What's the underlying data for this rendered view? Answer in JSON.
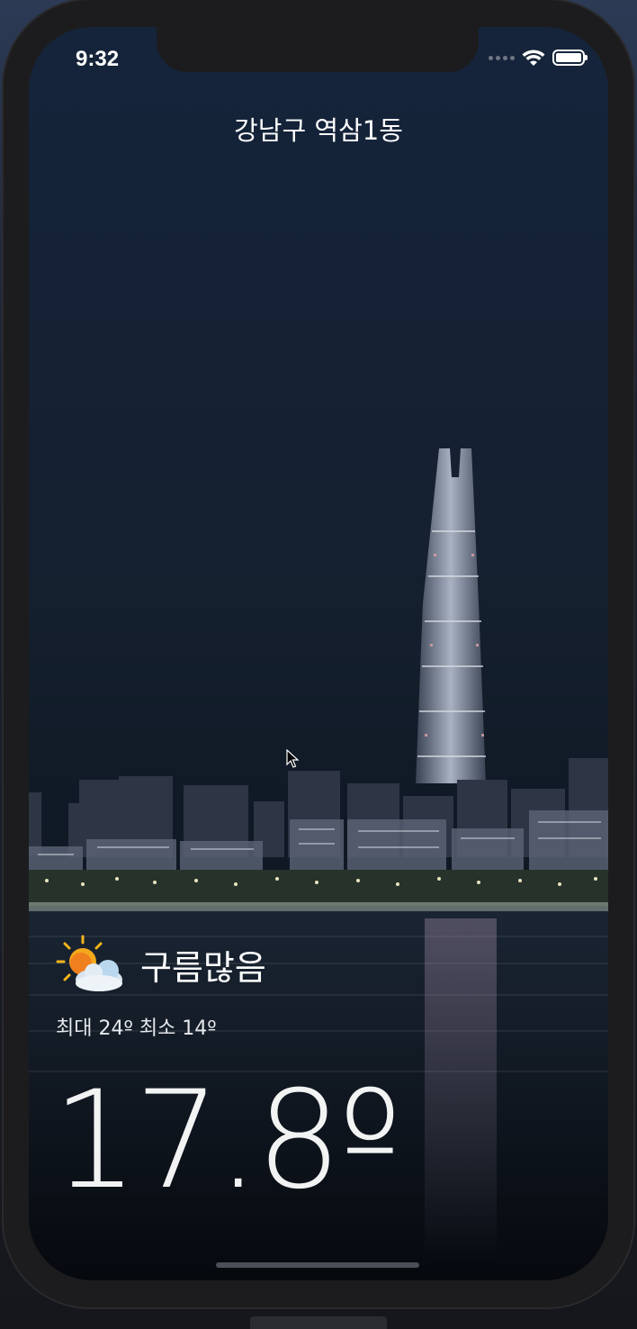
{
  "status_bar": {
    "time": "9:32",
    "icons": [
      "signal-dots-icon",
      "wifi-icon",
      "battery-icon"
    ]
  },
  "location": "강남구 역삼1동",
  "weather": {
    "condition": "구름많음",
    "condition_icon": "partly-cloudy-icon",
    "minmax": "최대 24º 최소 14º",
    "temperature": "17.8º"
  },
  "colors": {
    "text": "#ffffff",
    "sky_top": "#14233a",
    "water": "#0b121b",
    "device": "#1c1c1e"
  }
}
